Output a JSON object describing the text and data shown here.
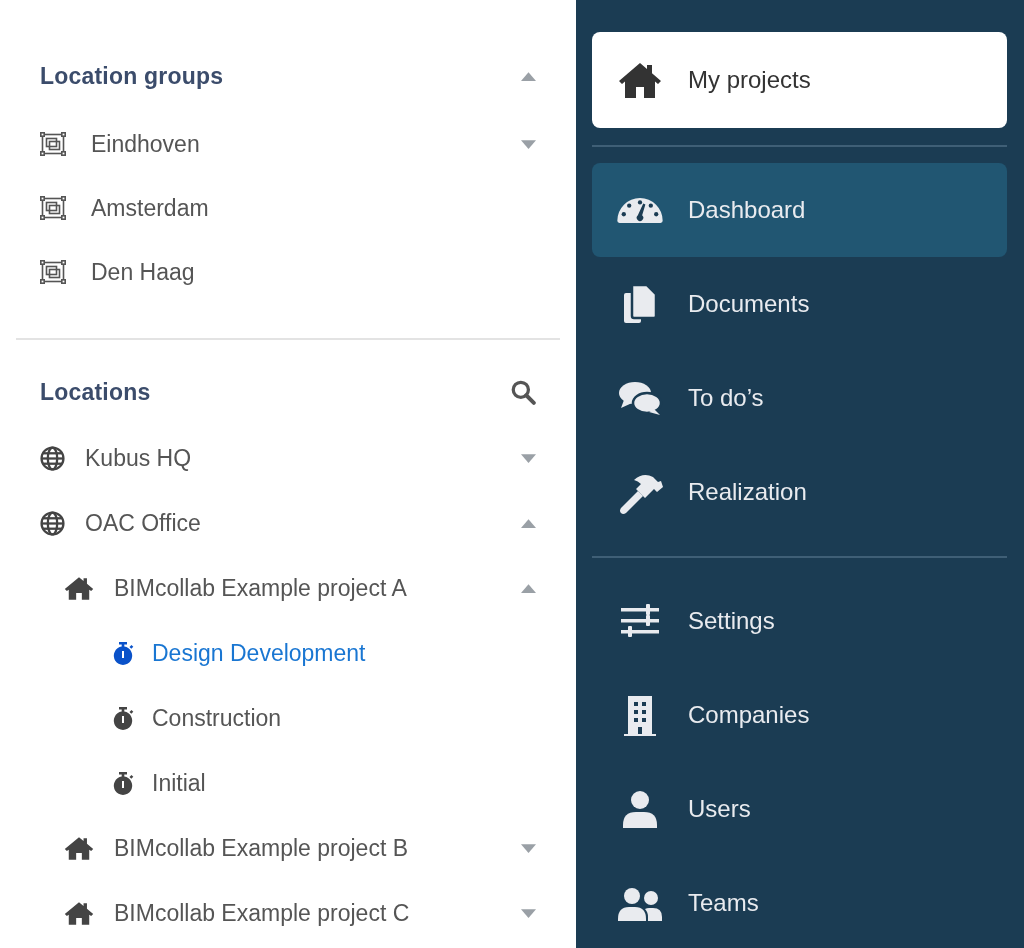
{
  "location_groups": {
    "title": "Location groups",
    "expanded": true,
    "items": [
      {
        "label": "Eindhoven",
        "expanded": false
      },
      {
        "label": "Amsterdam"
      },
      {
        "label": "Den Haag"
      }
    ]
  },
  "locations": {
    "title": "Locations",
    "items": [
      {
        "label": "Kubus HQ",
        "expanded": false
      },
      {
        "label": "OAC Office",
        "expanded": true,
        "children": [
          {
            "label": "BIMcollab Example project A",
            "expanded": true,
            "children": [
              {
                "label": "Design Development",
                "selected": true
              },
              {
                "label": "Construction",
                "selected": false
              },
              {
                "label": "Initial",
                "selected": false
              }
            ]
          },
          {
            "label": "BIMcollab Example project B",
            "expanded": false
          },
          {
            "label": "BIMcollab Example project C",
            "expanded": false
          }
        ]
      }
    ]
  },
  "nav": {
    "sections": [
      {
        "kind": "card",
        "items": [
          {
            "label": "My projects"
          }
        ]
      },
      {
        "kind": "list",
        "items": [
          {
            "label": "Dashboard",
            "selected": true
          },
          {
            "label": "Documents",
            "selected": false
          },
          {
            "label": "To do’s",
            "selected": false
          },
          {
            "label": "Realization",
            "selected": false
          }
        ]
      },
      {
        "kind": "list",
        "items": [
          {
            "label": "Settings",
            "selected": false
          },
          {
            "label": "Companies",
            "selected": false
          },
          {
            "label": "Users",
            "selected": false
          },
          {
            "label": "Teams",
            "selected": false
          }
        ]
      }
    ]
  }
}
